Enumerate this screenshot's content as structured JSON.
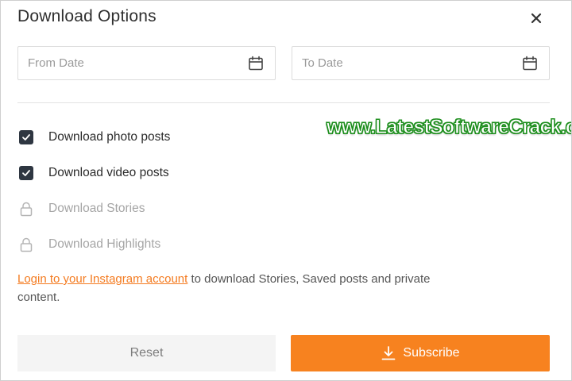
{
  "dialog": {
    "title": "Download Options"
  },
  "date_range": {
    "from_placeholder": "From Date",
    "to_placeholder": "To Date",
    "from_value": "",
    "to_value": ""
  },
  "options": [
    {
      "label": "Download photo posts",
      "state": "checked"
    },
    {
      "label": "Download video posts",
      "state": "checked"
    },
    {
      "label": "Download Stories",
      "state": "locked"
    },
    {
      "label": "Download Highlights",
      "state": "locked"
    }
  ],
  "notice": {
    "link_text": "Login to your Instagram account",
    "rest_text": " to download Stories, Saved posts and private content."
  },
  "watermark": {
    "text": "www.LatestSoftwareCrack.com"
  },
  "buttons": {
    "reset_label": "Reset",
    "subscribe_label": "Subscribe"
  },
  "colors": {
    "accent": "#f7821f",
    "link": "#f47b20",
    "checkbox": "#2e3641",
    "watermark_outline": "#1e8f1e"
  },
  "icons": {
    "close": "close-icon",
    "date": "calendar-icon",
    "checked": "check-icon",
    "locked": "lock-icon",
    "subscribe": "download-icon"
  }
}
